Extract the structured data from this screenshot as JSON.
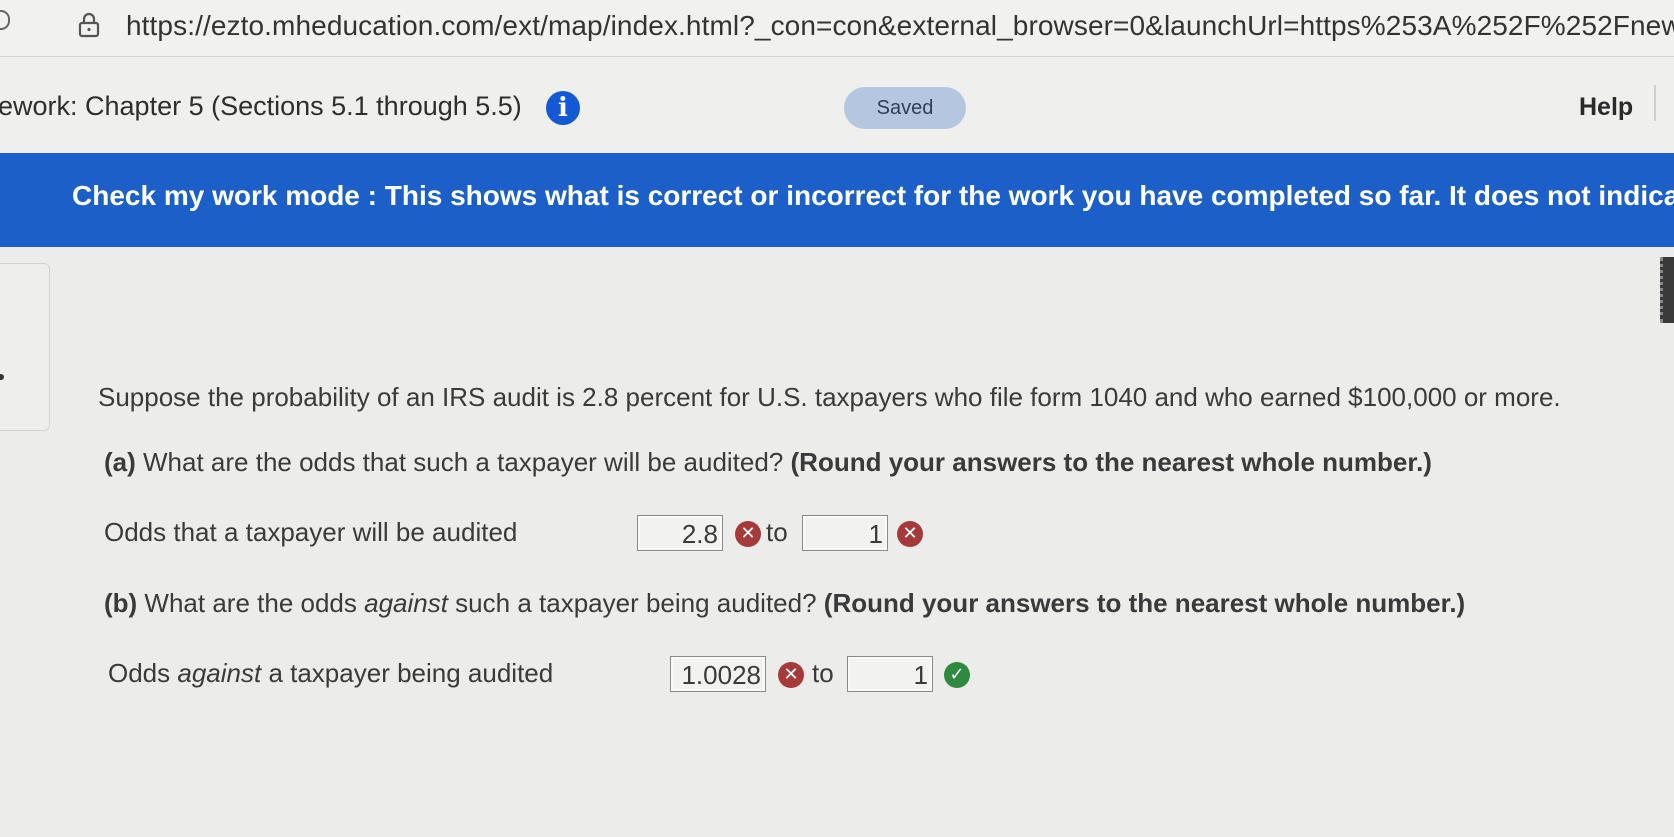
{
  "browser": {
    "url": "https://ezto.mheducation.com/ext/map/index.html?_con=con&external_browser=0&launchUrl=https%253A%252F%252Fnew"
  },
  "header": {
    "assignment_title": "ework: Chapter 5 (Sections 5.1 through 5.5)",
    "info_glyph": "i",
    "saved_label": "Saved",
    "help_label": "Help"
  },
  "banner": {
    "text": "Check my work mode : This shows what is correct or incorrect for the work you have completed so far. It does not indicate com"
  },
  "question": {
    "stem": "Suppose the probability of an IRS audit is 2.8 percent for U.S. taxpayers who file form 1040 and who earned $100,000 or more.",
    "part_a": {
      "letter": "(a)",
      "prompt": " What are the odds that such a taxpayer will be audited? ",
      "instruction": "(Round your answers to the nearest whole number.)",
      "row_label": "Odds that a taxpayer will be audited",
      "answer1": "2.8",
      "answer1_status": "incorrect",
      "to_text": "to",
      "answer2": "1",
      "answer2_status": "incorrect"
    },
    "part_b": {
      "letter": "(b)",
      "prompt_pre": " What are the odds ",
      "prompt_em": "against",
      "prompt_post": " such a taxpayer being audited? ",
      "instruction": "(Round your answers to the nearest whole number.)",
      "row_label_pre": "Odds ",
      "row_label_em": "against",
      "row_label_post": " a taxpayer being audited",
      "answer1": "1.0028",
      "answer1_status": "incorrect",
      "to_text": "to",
      "answer2": "1",
      "answer2_status": "correct"
    }
  },
  "icons": {
    "incorrect": "x-circle-icon",
    "correct": "check-circle-icon",
    "lock": "lock-icon",
    "info": "info-icon"
  },
  "colors": {
    "banner": "#1d5fc9",
    "info": "#1558d6",
    "incorrect": "#a63a3a",
    "correct": "#2d8a3e",
    "saved_pill": "#b5c7e0"
  }
}
